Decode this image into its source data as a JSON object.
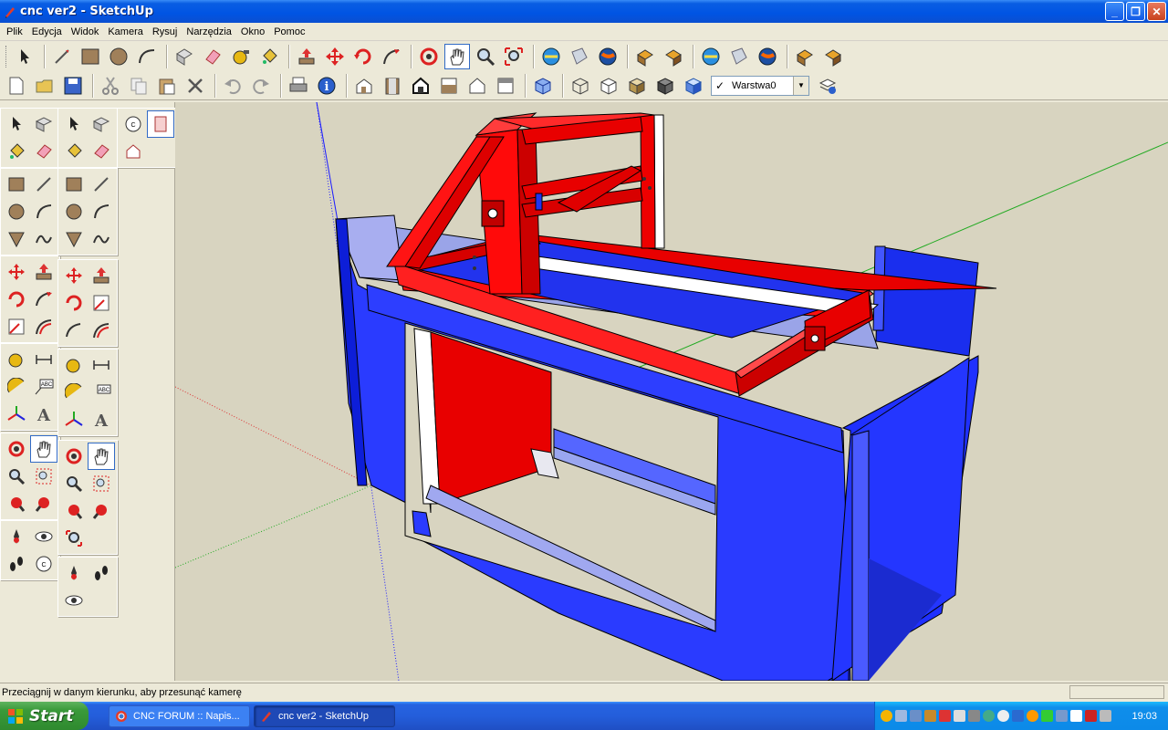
{
  "window": {
    "title": "cnc ver2 - SketchUp",
    "minimize_glyph": "_",
    "maximize_glyph": "❐",
    "close_glyph": "✕"
  },
  "menu": [
    "Plik",
    "Edycja",
    "Widok",
    "Kamera",
    "Rysuj",
    "Narzędzia",
    "Okno",
    "Pomoc"
  ],
  "layers": {
    "current": "Warstwa0",
    "check": "✓"
  },
  "status": {
    "message": "Przeciągnij w danym kierunku, aby przesunąć kamerę"
  },
  "taskbar": {
    "start_label": "Start",
    "tasks": [
      {
        "label": "CNC FORUM :: Napis..."
      },
      {
        "label": "cnc ver2 - SketchUp"
      }
    ],
    "clock": "19:03"
  },
  "colors": {
    "model_blue": "#3333ff",
    "model_red": "#ee0000",
    "background": "#d8d4c0"
  }
}
